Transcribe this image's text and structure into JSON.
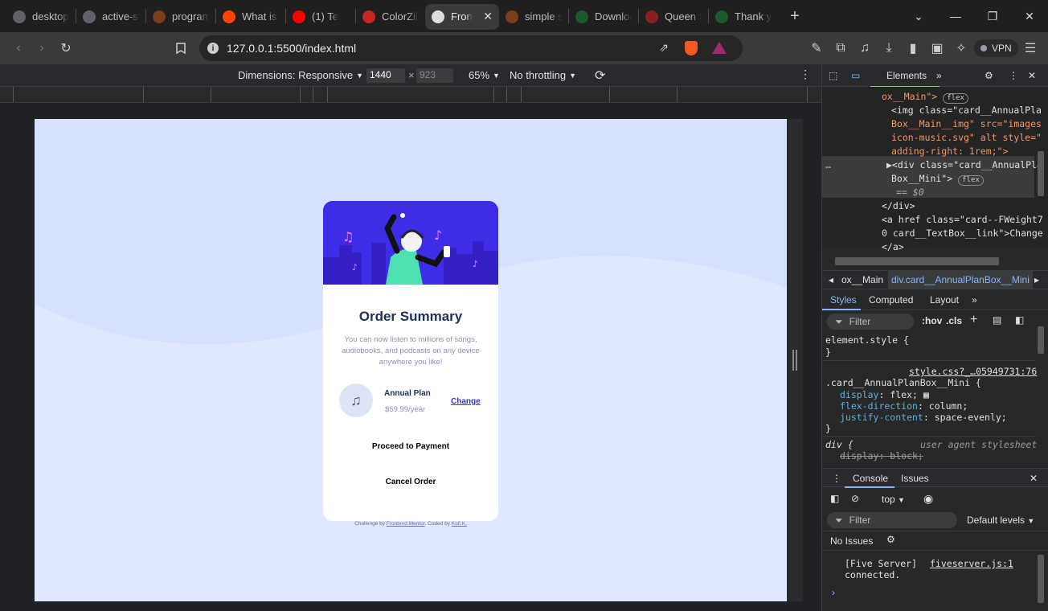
{
  "tabs": [
    {
      "label": "desktop-",
      "fav_color": "#5f6368"
    },
    {
      "label": "active-st",
      "fav_color": "#5f6368"
    },
    {
      "label": "programm",
      "fav_color": "#7a3e1d"
    },
    {
      "label": "What is t",
      "fav_color": "#ff4500"
    },
    {
      "label": "(1) Te",
      "fav_color": "#ff0000"
    },
    {
      "label": "ColorZilla",
      "fav_color": "#c62828"
    },
    {
      "label": "Fron",
      "fav_color": "#dddddd"
    },
    {
      "label": "simple sc",
      "fav_color": "#7a3e1d"
    },
    {
      "label": "Downloa",
      "fav_color": "#1e5a2b"
    },
    {
      "label": "Queen S",
      "fav_color": "#8b1f1f"
    },
    {
      "label": "Thank yo",
      "fav_color": "#1e5a2b"
    }
  ],
  "address": {
    "url": "127.0.0.1:5500/index.html"
  },
  "vpn_label": "VPN",
  "device_toolbar": {
    "dimensions": "Dimensions: Responsive",
    "width": "1440",
    "times": "×",
    "height": "923",
    "zoom": "65%",
    "throttling": "No throttling"
  },
  "card": {
    "title": "Order Summary",
    "description": "You can now listen to millions of songs, audiobooks, and podcasts on any device anywhere you like!",
    "plan_name": "Annual Plan",
    "plan_price": "$59.99/year",
    "change_link": "Change",
    "proceed": "Proceed to Payment",
    "cancel": "Cancel Order"
  },
  "footer": {
    "prefix": "Challenge by ",
    "fm": "Frontend Mentor",
    "mid": ". Coded by ",
    "author": "Kofi K."
  },
  "devtools": {
    "tab_elements": "Elements",
    "elements_lines": [
      "ox__Main\">",
      "<img class=\"card__AnnualPla",
      "Box__Main__img\" src=\"images",
      "icon-music.svg\" alt style=\"",
      "adding-right: 1rem;\">",
      "▶<div class=\"card__AnnualPla",
      "Box__Mini\">",
      "== $0",
      "</div>",
      "<a href class=\"card--FWeight7",
      "0 card__TextBox__link\">Change",
      "</a>"
    ],
    "flex_pill": "flex",
    "dots": "…",
    "crumb_1": "ox__Main",
    "crumb_2": "div.card__AnnualPlanBox__Mini",
    "subtabs": [
      "Styles",
      "Computed",
      "Layout"
    ],
    "filter": "Filter",
    "hov": ":hov",
    "cls": ".cls",
    "element_style": "element.style {",
    "close_brace": "}",
    "source": "style.css?_…05949731:76",
    "selector": ".card__AnnualPlanBox__Mini {",
    "decl_1_prop": "display",
    "decl_1_val": "flex;",
    "decl_2_prop": "flex-direction",
    "decl_2_val": "column;",
    "decl_3_prop": "justify-content",
    "decl_3_val": "space-evenly;",
    "div_selector": "div {",
    "ua": "user agent stylesheet",
    "ua_decl": "display: block;",
    "console_tab": "Console",
    "issues_tab": "Issues",
    "context": "top",
    "console_filter": "Filter",
    "levels": "Default levels",
    "no_issues": "No Issues",
    "log_1": "[Five Server]",
    "log_link": "fiveserver.js:1",
    "log_2": "connected."
  }
}
